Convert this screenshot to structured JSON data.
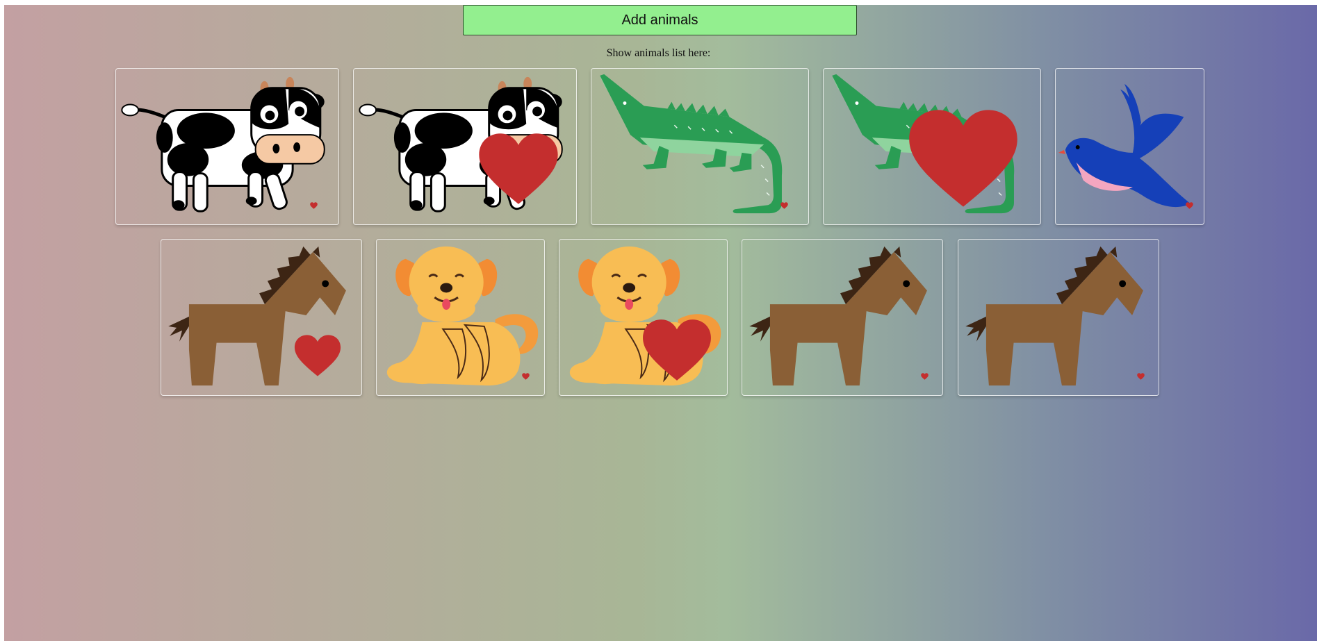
{
  "toolbar": {
    "add_label": "Add animals"
  },
  "list": {
    "caption": "Show animals list here:"
  },
  "colors": {
    "button_bg": "#93ef8f",
    "heart": "#c42e2e"
  },
  "animals": [
    {
      "kind": "cow",
      "favorite": false
    },
    {
      "kind": "cow",
      "favorite": true
    },
    {
      "kind": "crocodile",
      "favorite": false
    },
    {
      "kind": "crocodile",
      "favorite": true
    },
    {
      "kind": "bird",
      "favorite": false
    },
    {
      "kind": "horse",
      "favorite": true
    },
    {
      "kind": "dog",
      "favorite": false
    },
    {
      "kind": "dog",
      "favorite": true
    },
    {
      "kind": "horse",
      "favorite": false
    },
    {
      "kind": "horse",
      "favorite": false
    }
  ]
}
